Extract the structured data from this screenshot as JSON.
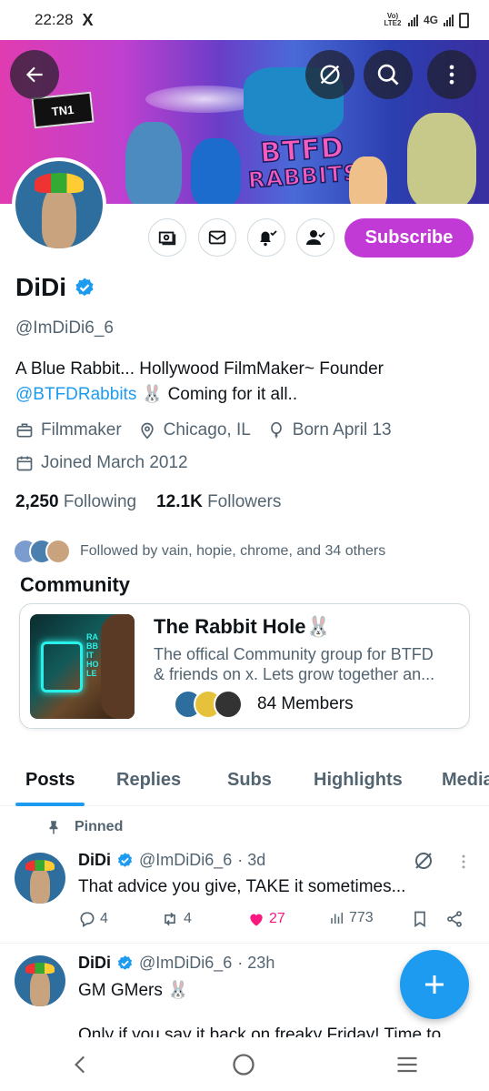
{
  "status_bar": {
    "time": "22:28",
    "x_logo": "X",
    "network_label": "Vo) LTE2",
    "network_type": "4G"
  },
  "banner": {
    "logo_text": "TN1",
    "title_line1": "BTFD",
    "title_line2": "RABBITS",
    "icons": [
      "back-arrow-icon",
      "no-activity-icon",
      "search-icon",
      "more-vertical-icon"
    ]
  },
  "profile": {
    "name": "DiDi",
    "handle": "@ImDiDi6_6",
    "bio_part1": "A Blue Rabbit... Hollywood FilmMaker~ Founder",
    "bio_link": "@BTFDRabbits",
    "bio_emoji": "🐰",
    "bio_part2": "Coming for it all..",
    "profession": "Filmmaker",
    "location": "Chicago, IL",
    "born": "Born April 13",
    "joined": "Joined March 2012",
    "following_count": "2,250",
    "following_label": "Following",
    "followers_count": "12.1K",
    "followers_label": "Followers",
    "followed_by": "Followed by vain, hopie, chrome, and 34 others",
    "subscribe_label": "Subscribe"
  },
  "community": {
    "heading": "Community",
    "title": "The Rabbit Hole",
    "title_emoji": "🐰",
    "description_line1": "The offical Community group for BTFD",
    "description_line2": "& friends on x. Lets grow together an...",
    "members": "84 Members",
    "thumb_text": "RABBIT HOLE"
  },
  "tabs": [
    "Posts",
    "Replies",
    "Subs",
    "Highlights",
    "Media"
  ],
  "posts": [
    {
      "pinned_label": "Pinned",
      "author": "DiDi",
      "handle": "@ImDiDi6_6",
      "time": "· 3d",
      "text": "That advice you give, TAKE it sometimes...",
      "replies": "4",
      "reposts": "4",
      "likes": "27",
      "views": "773"
    },
    {
      "author": "DiDi",
      "handle": "@ImDiDi6_6",
      "time": "· 23h",
      "text": "GM GMers",
      "text_emoji": "🐰",
      "text_line2": "Only if you say it back on freaky Friday! Time to"
    }
  ],
  "colors": {
    "accent": "#1d9bf0",
    "subscribe": "#c23ad6",
    "like": "#f91880",
    "muted": "#536471"
  }
}
